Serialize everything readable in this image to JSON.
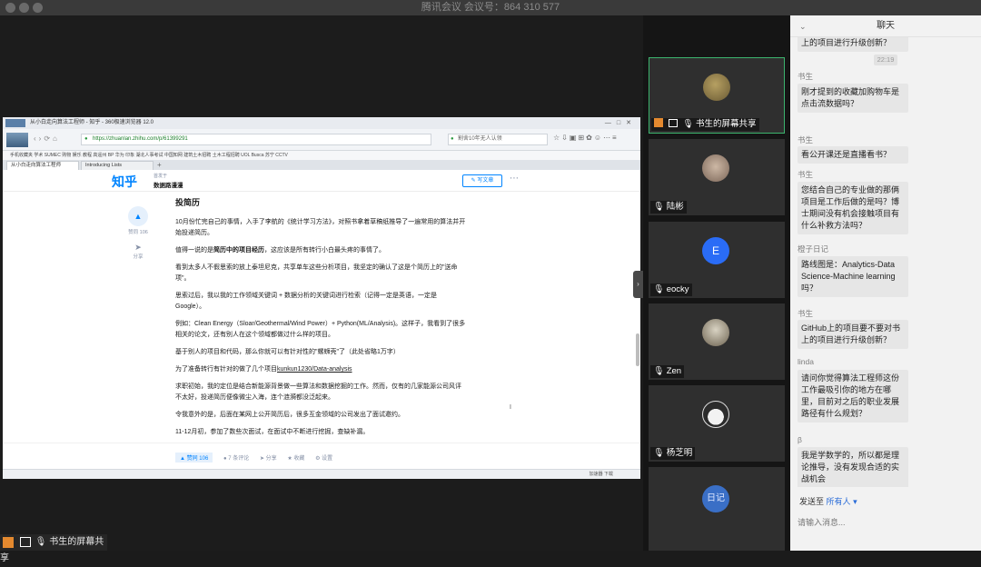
{
  "window": {
    "title": "腾讯会议 会议号：864 310 577"
  },
  "browser": {
    "title": "从小白走向算法工程师 - 知乎 - 360极速浏览器 12.0",
    "url": "https://zhuanlan.zhihu.com/p/61399291",
    "search_placeholder": "割舍10年无人认领",
    "bookmarks": "手机收藏夹  学术  SUMEC  购物  娱乐  教程  高遥州  BP  华为  印象  湖北人事考试  中国知网  建筑土木招聘  土木工程招聘  UOL Busca  苏宁  CCTV",
    "tabs": [
      "从小白走向算法工程师",
      "Introducing Lists"
    ],
    "status_right": "加速器    下载"
  },
  "zhihu": {
    "logo": "知乎",
    "column_label": "首发于",
    "column_name": "数据路漫漫",
    "write_button": "写文章",
    "vote_label": "赞同 106",
    "share_label": "分享",
    "article": {
      "heading": "投简历",
      "p1": "10月份忙完自己的事情，入手了李航的《统计学习方法》，对照书拿着草稿纸推导了一遍常用的算法并开始投递简历。",
      "p2_pre": "值得一说的是",
      "p2_bold": "简历中的项目经历",
      "p2_post": "，这应该是所有转行小白最头疼的事情了。",
      "p3": "看到太多人不假思索的放上泰坦尼克，共享单车这些分析项目，我坚定的确认了这是个简历上的\"送命项\"。",
      "p4": "思索过后，我以我的工作领域关键词 + 数据分析的关键词进行检索（记得一定是英语，一定是Google）。",
      "p5": "例如：Clean Energy（Sloar/Geothermal/Wind Power）+ Python(ML/Analysis)。这样子，我看到了很多相关的论文，还有别人在这个领域都做过什么样的项目。",
      "p6": "基于别人的项目和代码，那么你就可以有针对性的\"螺蛳壳\"了（此处省略1万字）",
      "p7_pre": "为了准备转行有针对的做了几个项目",
      "p7_link": "kunkun1230/Data-analysis",
      "p8": "求职初始，我的定位是结合新能源背景做一些算法和数据挖掘的工作。然而，仅有的几家能源公司风评不太好，投递简历便像微尘入海，连个涟漪都没泛起来。",
      "p9": "令我意外的是，后面在某网上公开简历后，很多互金领域的公司发出了面试邀约。",
      "p10": "11-12月初，参加了数些次面试，在面试中不断进行挖掘，查缺补漏。"
    },
    "actions": [
      "赞同 106",
      "7 条评论",
      "分享",
      "收藏",
      "设置"
    ]
  },
  "sharer": {
    "label": "书生的屏幕共享"
  },
  "participants": [
    {
      "name": "书生的屏幕共享"
    },
    {
      "name": "陆彬"
    },
    {
      "name": "eocky",
      "initial": "E"
    },
    {
      "name": "Zen"
    },
    {
      "name": "杨芝明"
    },
    {
      "name": "日记"
    }
  ],
  "colors": {
    "active_border": "#3cb46e",
    "eocky_avatar": "#2a6cf6",
    "link_blue": "#2a6cd8"
  },
  "chat": {
    "title": "聊天",
    "top_clip": "上的项目进行升级创新？",
    "time": "22:19",
    "messages": [
      {
        "sender": "书生",
        "text": "刚才提到的收藏加购物车是点击流数据吗？"
      },
      {
        "sender": "书生",
        "text": "看公开课还是直播看书？"
      },
      {
        "sender": "书生",
        "text": "您结合自己的专业做的那俩项目是工作后做的是吗？博士期间没有机会接触项目有什么补救方法吗？"
      },
      {
        "sender": "橙子日记",
        "text": "路线图是：Analytics-Data Science-Machine learning吗？"
      },
      {
        "sender": "书生",
        "text": "GitHub上的项目要不要对书上的项目进行升级创新？"
      },
      {
        "sender": "linda",
        "text": "请问你觉得算法工程师这份工作最吸引你的地方在哪里，目前对之后的职业发展路径有什么规划？"
      },
      {
        "sender": "β",
        "text": "我是学数学的，所以都是理论推导，没有发现合适的实战机会"
      }
    ],
    "send_to_label": "发送至",
    "send_to_target": "所有人",
    "input_placeholder": "请输入消息..."
  }
}
